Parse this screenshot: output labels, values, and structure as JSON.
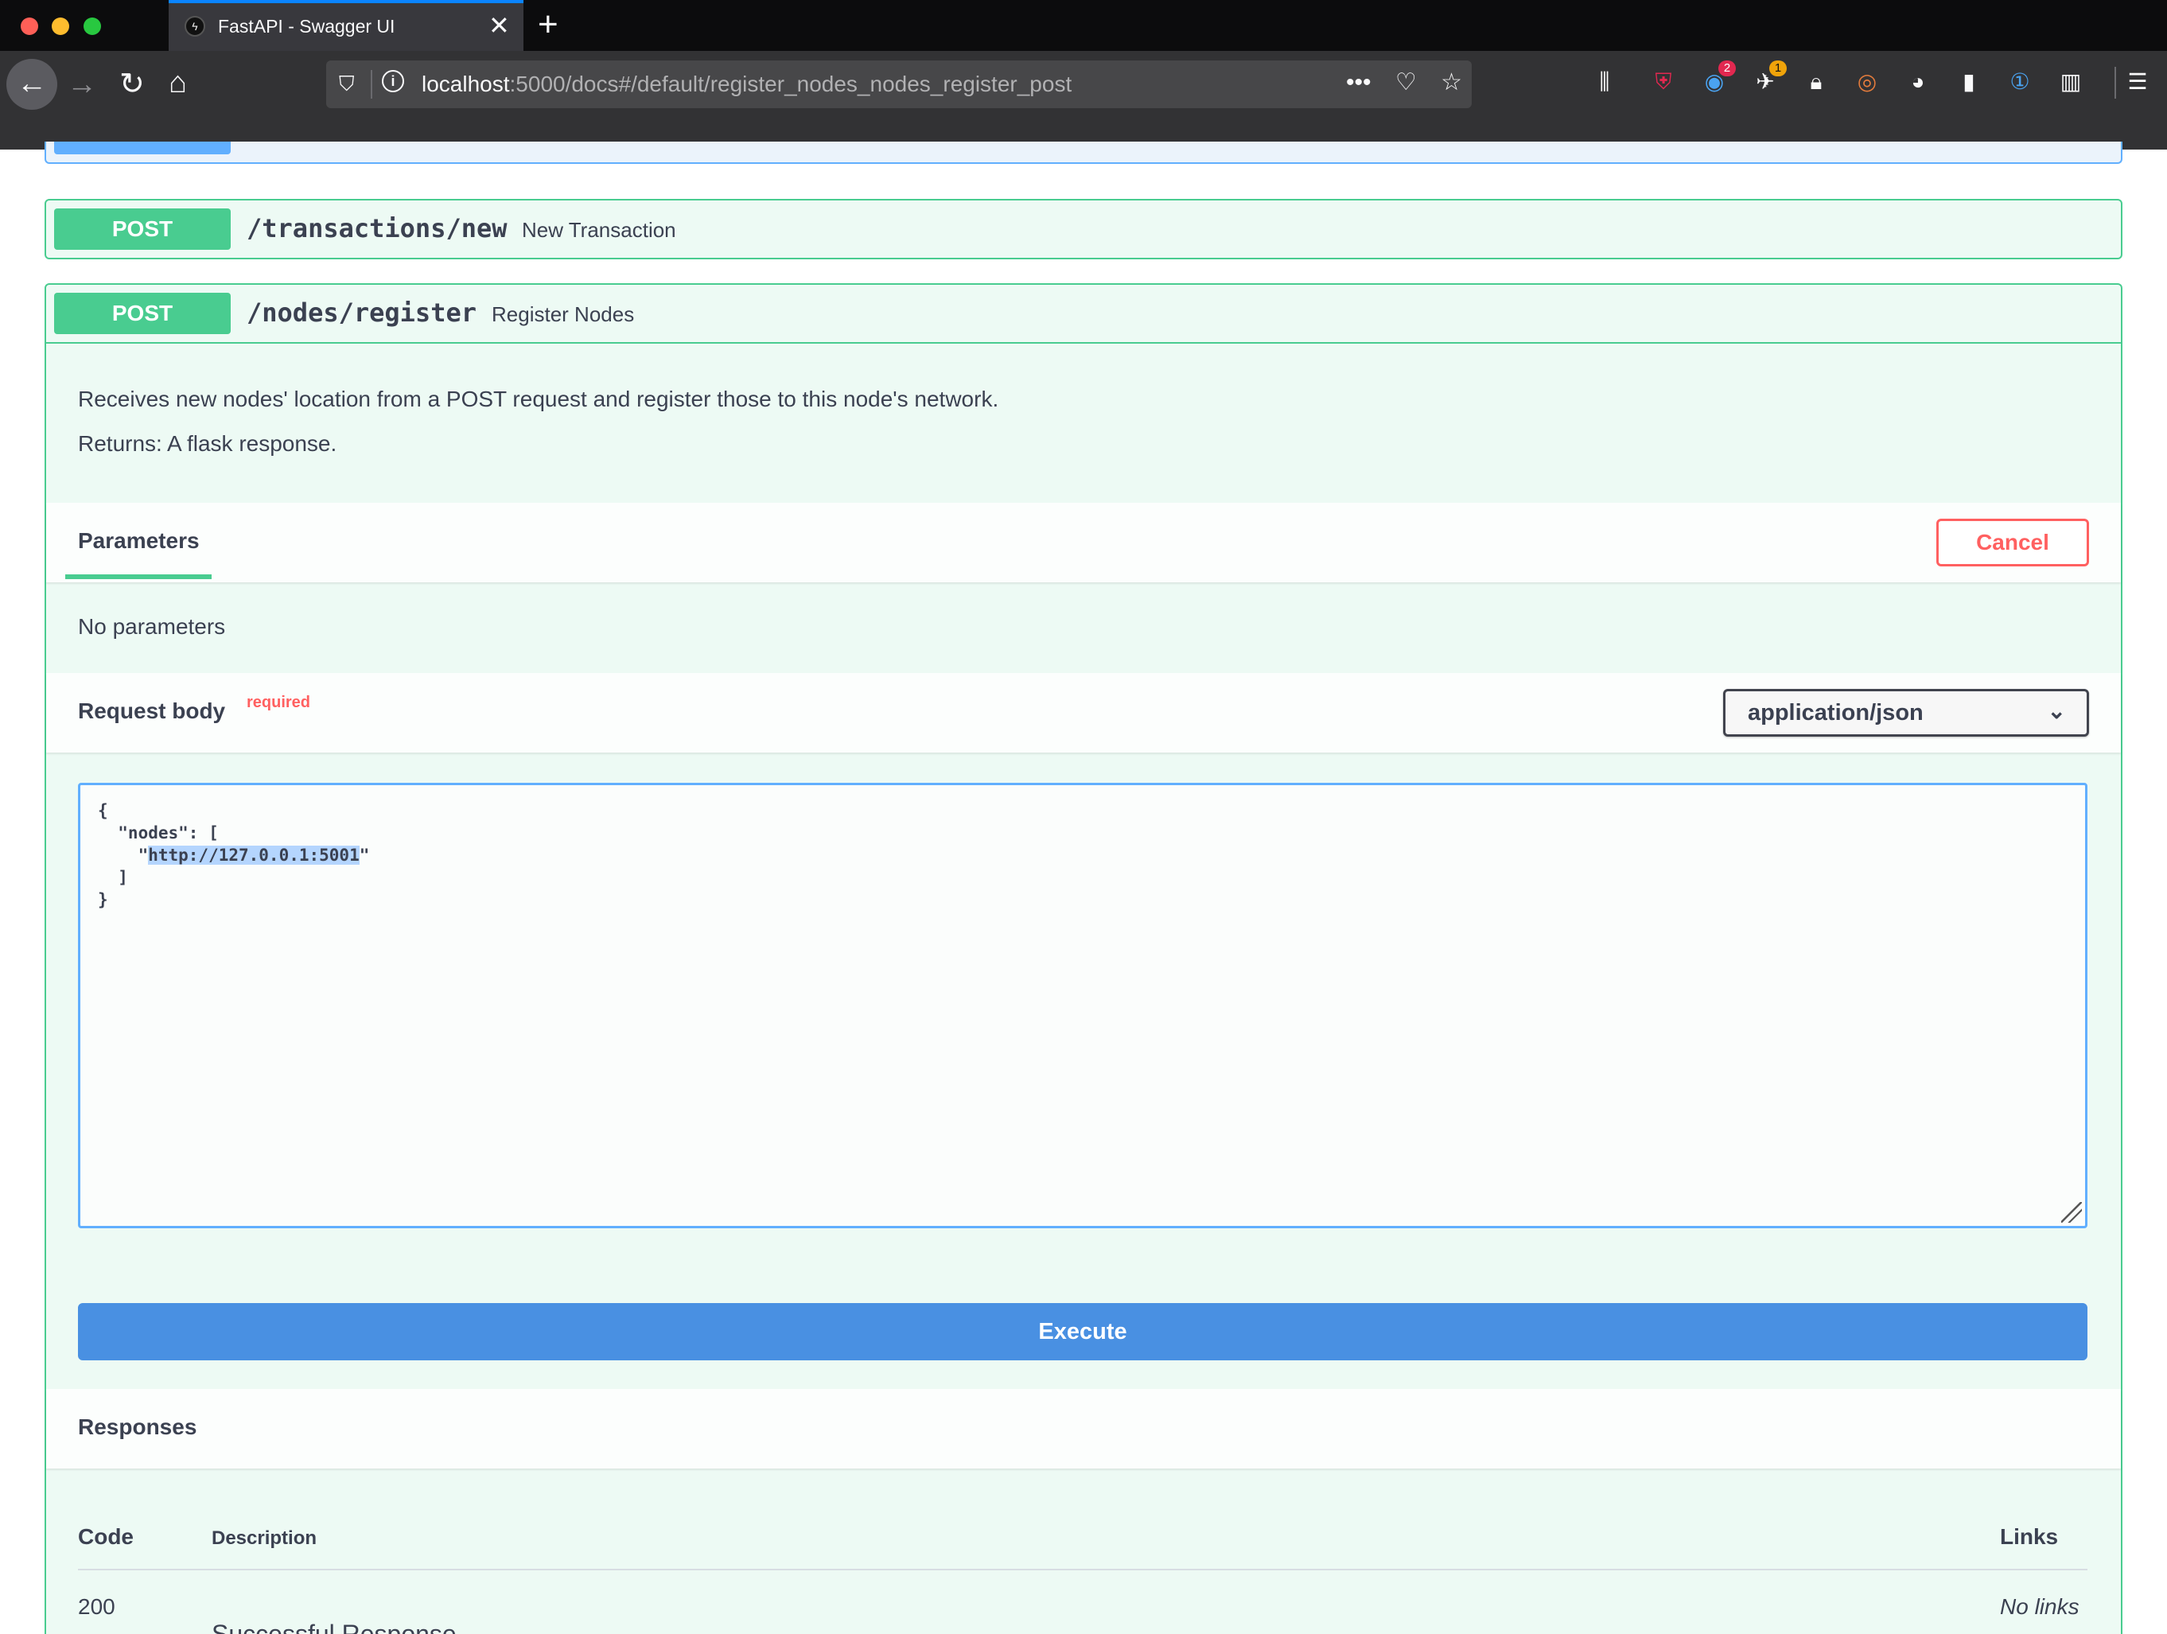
{
  "browser": {
    "tab_title": "FastAPI - Swagger UI",
    "url_host": "localhost",
    "url_rest": ":5000/docs#/default/register_nodes_nodes_register_post",
    "extension_badges": {
      "counter_a": "2",
      "counter_b": "1"
    }
  },
  "icons": [
    "back-arrow-icon",
    "forward-arrow-icon",
    "reload-icon",
    "home-icon",
    "shield-icon",
    "info-icon",
    "more-icon",
    "pocket-icon",
    "star-icon",
    "library-icon",
    "ublock-icon",
    "menu-icon"
  ],
  "operations": [
    {
      "method": "POST",
      "path": "/transactions/new",
      "summary": "New Transaction"
    },
    {
      "method": "POST",
      "path": "/nodes/register",
      "summary": "Register Nodes",
      "description_lines": [
        "Receives new nodes' location from a POST request and register those to this node's network.",
        "Returns: A flask response."
      ],
      "parameters": {
        "title": "Parameters",
        "cancel_label": "Cancel",
        "empty_text": "No parameters"
      },
      "request_body": {
        "title": "Request body",
        "required_label": "required",
        "content_type": "application/json",
        "lines": [
          "{",
          "  \"nodes\": [",
          "    \"",
          "http://127.0.0.1:5001",
          "\"",
          "  ]",
          "}"
        ]
      },
      "execute_label": "Execute",
      "responses": {
        "title": "Responses",
        "headers": {
          "code": "Code",
          "description": "Description",
          "links": "Links"
        },
        "rows": [
          {
            "code": "200",
            "description": "Successful Response",
            "links": "No links"
          }
        ]
      }
    }
  ],
  "colors": {
    "post": "#49cc90",
    "get": "#61affe",
    "execute": "#4990e2",
    "cancel": "#ff6060"
  }
}
